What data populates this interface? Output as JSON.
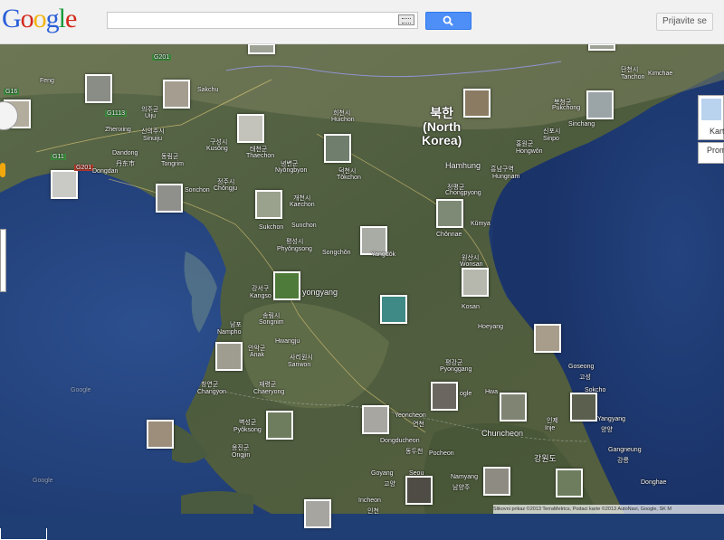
{
  "header": {
    "logo_text": [
      "G",
      "o",
      "o",
      "g",
      "l",
      "e"
    ],
    "search_placeholder": "",
    "signin_label": "Prijavite se"
  },
  "controls": {
    "maptype_label": "Kart",
    "prom_label": "Prom"
  },
  "attribution": "Slikovni prikaz ©2013 TerraMetrics, Podaci karte ©2013 AutoNavi, Google, SK M",
  "country_label": {
    "korean": "북한",
    "english_line1": "(North",
    "english_line2": "Korea)"
  },
  "places": [
    {
      "id": "kimchaek",
      "text": "Kimchae"
    },
    {
      "id": "danchon-ko",
      "text": "단천시"
    },
    {
      "id": "tanchon",
      "text": "Tanchon"
    },
    {
      "id": "feng",
      "text": "Feng"
    },
    {
      "id": "sakchu",
      "text": "Sakchu"
    },
    {
      "id": "g201",
      "text": "G201"
    },
    {
      "id": "g16",
      "text": "G16"
    },
    {
      "id": "g1113",
      "text": "G1113"
    },
    {
      "id": "g11",
      "text": "G11"
    },
    {
      "id": "g201b",
      "text": "G201"
    },
    {
      "id": "uiju-ko",
      "text": "의주군"
    },
    {
      "id": "uiju",
      "text": "Uiju"
    },
    {
      "id": "zhenxing",
      "text": "Zhenxing"
    },
    {
      "id": "sinuiju-ko",
      "text": "신의주시"
    },
    {
      "id": "sinuiju",
      "text": "Sinuiju"
    },
    {
      "id": "dandong",
      "text": "Dandong"
    },
    {
      "id": "dandong-zh",
      "text": "丹东市"
    },
    {
      "id": "dongdan",
      "text": "Dongdan"
    },
    {
      "id": "tongrim-ko",
      "text": "동림군"
    },
    {
      "id": "tongrim",
      "text": "Tongrim"
    },
    {
      "id": "kusong-ko",
      "text": "구성시"
    },
    {
      "id": "kusong",
      "text": "Kusŏng"
    },
    {
      "id": "taechon-ko",
      "text": "태천군"
    },
    {
      "id": "thaechon",
      "text": "Thaechon"
    },
    {
      "id": "huichon-ko",
      "text": "희천시"
    },
    {
      "id": "huichon",
      "text": "Huichon"
    },
    {
      "id": "nyongbyon-ko",
      "text": "녕변군"
    },
    {
      "id": "nyongbyon",
      "text": "Nyŏngbyon"
    },
    {
      "id": "tokchon-ko",
      "text": "덕천시"
    },
    {
      "id": "tokchon",
      "text": "Tŏkchon"
    },
    {
      "id": "jongju-ko",
      "text": "정주시"
    },
    {
      "id": "chongju",
      "text": "Chŏngju"
    },
    {
      "id": "sonchon",
      "text": "Sonchon"
    },
    {
      "id": "kaechon-ko",
      "text": "개천시"
    },
    {
      "id": "kaechon",
      "text": "Kaechon"
    },
    {
      "id": "sukchon",
      "text": "Sukchon"
    },
    {
      "id": "sunchon",
      "text": "Sunchon"
    },
    {
      "id": "songchon",
      "text": "Songchŏn"
    },
    {
      "id": "pyongsong-ko",
      "text": "평성시"
    },
    {
      "id": "phyongsong",
      "text": "Phyŏngsong"
    },
    {
      "id": "yangdok",
      "text": "Yangdŏk"
    },
    {
      "id": "hamhung",
      "text": "Hamhung"
    },
    {
      "id": "hungnam-ko",
      "text": "흥남구역"
    },
    {
      "id": "hungnam",
      "text": "Hungnam"
    },
    {
      "id": "hongwon-ko",
      "text": "홍원군"
    },
    {
      "id": "hongwon",
      "text": "Hongwŏn"
    },
    {
      "id": "pukchong-ko",
      "text": "북청군"
    },
    {
      "id": "pukchong",
      "text": "Pukchong"
    },
    {
      "id": "sinpho-ko",
      "text": "신포시"
    },
    {
      "id": "sinpho",
      "text": "Sinpo"
    },
    {
      "id": "sinchang",
      "text": "Sinchang"
    },
    {
      "id": "jongpyong-ko",
      "text": "정평군"
    },
    {
      "id": "chongpyong",
      "text": "Chongpyong"
    },
    {
      "id": "kumya",
      "text": "Kŭmya"
    },
    {
      "id": "chonnae",
      "text": "Chŏnnae"
    },
    {
      "id": "wonsan-ko",
      "text": "원산시"
    },
    {
      "id": "wonsan",
      "text": "Wonsan"
    },
    {
      "id": "kosan",
      "text": "Kosan"
    },
    {
      "id": "hoeyang",
      "text": "Hoeyang"
    },
    {
      "id": "kangso-ko",
      "text": "강서구"
    },
    {
      "id": "kangso",
      "text": "Kangso"
    },
    {
      "id": "pyongyang",
      "text": "yongyang"
    },
    {
      "id": "songnim-ko",
      "text": "송림시"
    },
    {
      "id": "songnim",
      "text": "Songnim"
    },
    {
      "id": "nampo-ko",
      "text": "남포"
    },
    {
      "id": "nampho",
      "text": "Nampho"
    },
    {
      "id": "hwangju",
      "text": "Hwangju"
    },
    {
      "id": "anak-ko",
      "text": "안악군"
    },
    {
      "id": "anak",
      "text": "Anak"
    },
    {
      "id": "sariwon-ko",
      "text": "사리원시"
    },
    {
      "id": "sariwon",
      "text": "Sariwon"
    },
    {
      "id": "pyonggang-ko",
      "text": "평강군"
    },
    {
      "id": "pyonggang",
      "text": "Pyonggang"
    },
    {
      "id": "changyon-ko",
      "text": "창연군"
    },
    {
      "id": "changyon",
      "text": "Changyon"
    },
    {
      "id": "chaeryong-ko",
      "text": "재령군"
    },
    {
      "id": "chaeryong",
      "text": "Chaeryong"
    },
    {
      "id": "pyoksong-ko",
      "text": "벽성군"
    },
    {
      "id": "pyoksong",
      "text": "Pyŏksong"
    },
    {
      "id": "ongjin-ko",
      "text": "옹진군"
    },
    {
      "id": "ongjin",
      "text": "Ongjin"
    },
    {
      "id": "yeoncheon",
      "text": "Yeoncheon"
    },
    {
      "id": "yeoncheon-ko",
      "text": "연천"
    },
    {
      "id": "dongducheon",
      "text": "Dongducheon"
    },
    {
      "id": "dongducheon-ko",
      "text": "동두천"
    },
    {
      "id": "pocheon",
      "text": "Pocheon"
    },
    {
      "id": "chuncheon",
      "text": "Chuncheon"
    },
    {
      "id": "gangwondo",
      "text": "강원도"
    },
    {
      "id": "inje-ko",
      "text": "인제"
    },
    {
      "id": "inje",
      "text": "Inje"
    },
    {
      "id": "goseong",
      "text": "Goseong"
    },
    {
      "id": "goseong-ko",
      "text": "고성"
    },
    {
      "id": "sokcho",
      "text": "Sokcho"
    },
    {
      "id": "yangyang",
      "text": "Yangyang"
    },
    {
      "id": "yangyang-ko",
      "text": "양양"
    },
    {
      "id": "gangneung",
      "text": "Gangneung"
    },
    {
      "id": "gangneung-ko",
      "text": "강릉"
    },
    {
      "id": "goyang",
      "text": "Goyang"
    },
    {
      "id": "goyang-ko",
      "text": "고양"
    },
    {
      "id": "seoul",
      "text": "Seou"
    },
    {
      "id": "namyangju",
      "text": "Namyang"
    },
    {
      "id": "namyangju-ko",
      "text": "남양주"
    },
    {
      "id": "incheon",
      "text": "Incheon"
    },
    {
      "id": "incheon-ko",
      "text": "인천"
    },
    {
      "id": "donghae",
      "text": "Donghae"
    },
    {
      "id": "hwa",
      "text": "Hwa"
    },
    {
      "id": "ogle",
      "text": "ogle"
    },
    {
      "id": "google-wm1",
      "text": "Google"
    },
    {
      "id": "google-wm2",
      "text": "Google"
    }
  ]
}
